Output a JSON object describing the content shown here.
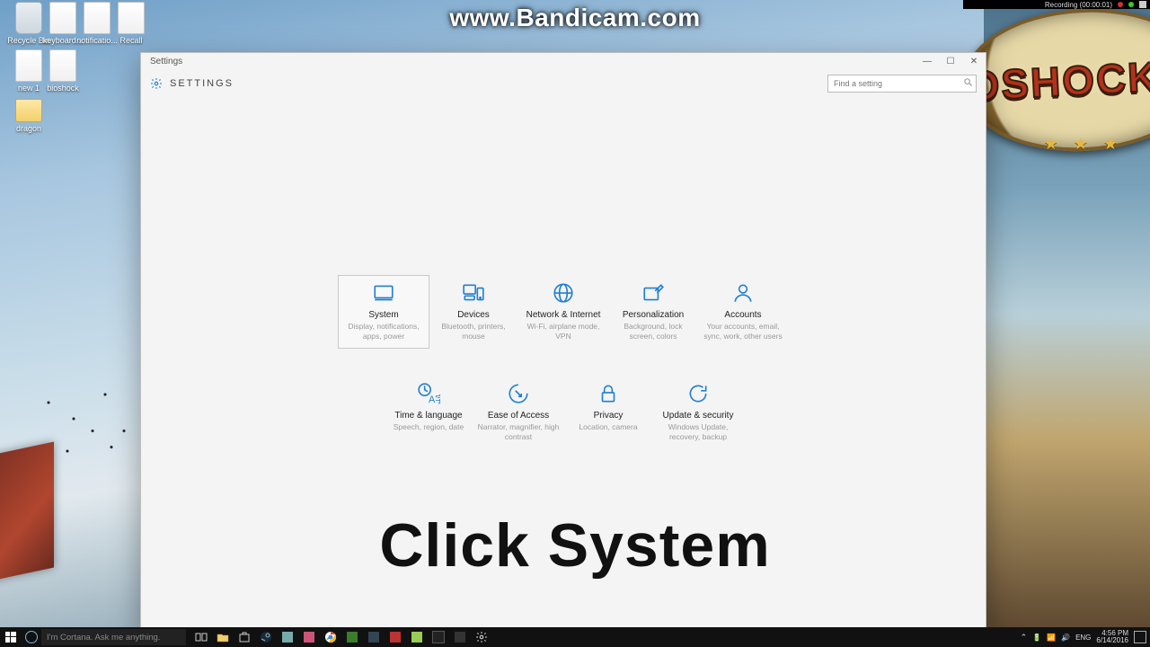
{
  "watermark": "www.Bandicam.com",
  "recorder_bar": {
    "status": "Recording (00:00:01)"
  },
  "wallpaper_logo": "IOSHOCK",
  "desktop_icons": [
    {
      "label": "Recycle Bin"
    },
    {
      "label": "keyboard..."
    },
    {
      "label": "notificatio..."
    },
    {
      "label": "Recall"
    },
    {
      "label": "new 1"
    },
    {
      "label": "bioshock"
    },
    {
      "label": "dragon"
    }
  ],
  "window": {
    "title": "Settings",
    "header": "SETTINGS",
    "search_placeholder": "Find a setting",
    "min_label": "—",
    "max_label": "☐",
    "close_label": "✕"
  },
  "categories_row1": [
    {
      "id": "system",
      "title": "System",
      "sub": "Display, notifications, apps, power",
      "selected": true
    },
    {
      "id": "devices",
      "title": "Devices",
      "sub": "Bluetooth, printers, mouse"
    },
    {
      "id": "network",
      "title": "Network & Internet",
      "sub": "Wi-Fi, airplane mode, VPN"
    },
    {
      "id": "personalization",
      "title": "Personalization",
      "sub": "Background, lock screen, colors"
    },
    {
      "id": "accounts",
      "title": "Accounts",
      "sub": "Your accounts, email, sync, work, other users"
    }
  ],
  "categories_row2": [
    {
      "id": "time",
      "title": "Time & language",
      "sub": "Speech, region, date"
    },
    {
      "id": "ease",
      "title": "Ease of Access",
      "sub": "Narrator, magnifier, high contrast"
    },
    {
      "id": "privacy",
      "title": "Privacy",
      "sub": "Location, camera"
    },
    {
      "id": "update",
      "title": "Update & security",
      "sub": "Windows Update, recovery, backup"
    }
  ],
  "overlay_instruction": "Click System",
  "taskbar": {
    "cortana_placeholder": "I'm Cortana. Ask me anything.",
    "time": "4:56 PM",
    "date": "6/14/2016",
    "lang": "ENG"
  },
  "accent": "#1f7fd1"
}
